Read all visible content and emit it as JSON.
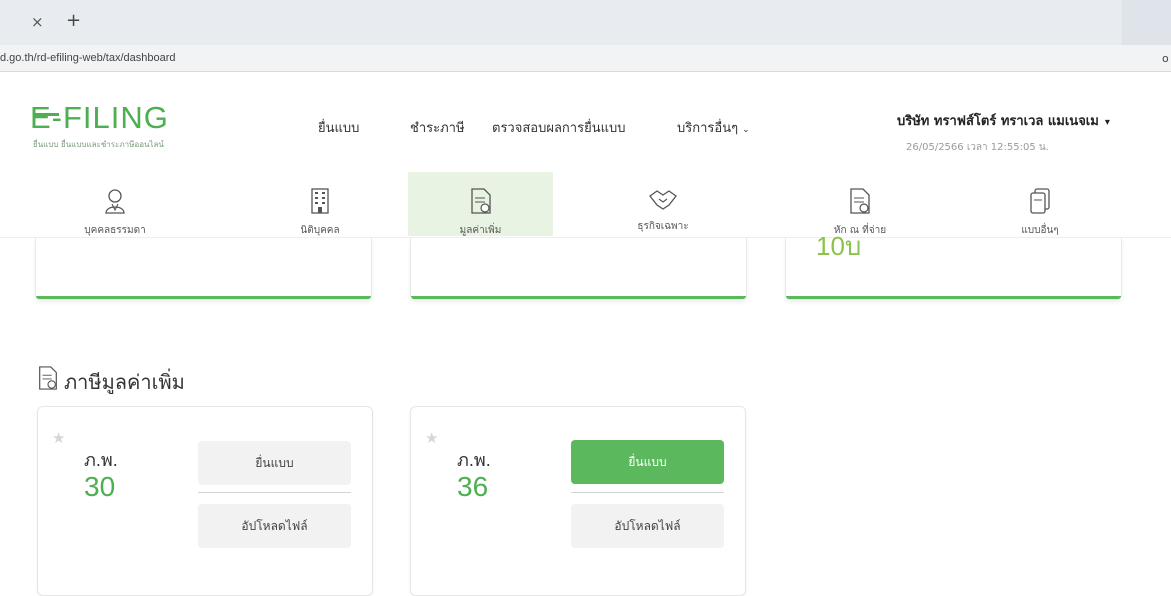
{
  "browser": {
    "tab_close": "×",
    "tab_new": "+",
    "url": "d.go.th/rd-efiling-web/tax/dashboard",
    "url_end": "o"
  },
  "header": {
    "logo_text": "E-FILING",
    "logo_subtitle": "ยื่นแบบ ยื่นแบบและชำระภาษีออนไลน์",
    "nav": [
      {
        "label": "ยื่นแบบ"
      },
      {
        "label": "ชำระภาษี"
      },
      {
        "label": "ตรวจสอบผลการยื่นแบบ"
      },
      {
        "label": "บริการอื่นๆ",
        "chevron": "⌄"
      }
    ],
    "company": "บริษัท ทราฟส์โตร์ ทราเวล แมเนจเม",
    "company_chevron": "▾",
    "datetime": "26/05/2566 เวลา 12:55:05 น."
  },
  "icon_tabs": [
    {
      "label": "บุคคลธรรมดา",
      "icon": "person-icon",
      "active": false
    },
    {
      "label": "นิติบุคคล",
      "icon": "building-icon",
      "active": false
    },
    {
      "label": "มูลค่าเพิ่ม",
      "icon": "document-icon",
      "active": true
    },
    {
      "label": "ธุรกิจเฉพาะ",
      "icon": "handshake-icon",
      "active": false
    },
    {
      "label": "หัก ณ ที่จ่าย",
      "icon": "document-icon",
      "active": false
    },
    {
      "label": "แบบอื่นๆ",
      "icon": "files-icon",
      "active": false
    }
  ],
  "partial_cards": [
    {
      "value": ""
    },
    {
      "value": ""
    },
    {
      "value": "10บ"
    }
  ],
  "section": {
    "title": "ภาษีมูลค่าเพิ่ม",
    "icon": "document-icon"
  },
  "forms": [
    {
      "code": "ภ.พ.",
      "number": "30",
      "file_label": "ยื่นแบบ",
      "upload_label": "อัปโหลดไฟล์",
      "primary": false
    },
    {
      "code": "ภ.พ.",
      "number": "36",
      "file_label": "ยื่นแบบ",
      "upload_label": "อัปโหลดไฟล์",
      "primary": true
    }
  ],
  "colors": {
    "brand_green": "#4caf50",
    "button_green": "#5cb85c",
    "active_tab_bg": "#e8f3e3"
  }
}
